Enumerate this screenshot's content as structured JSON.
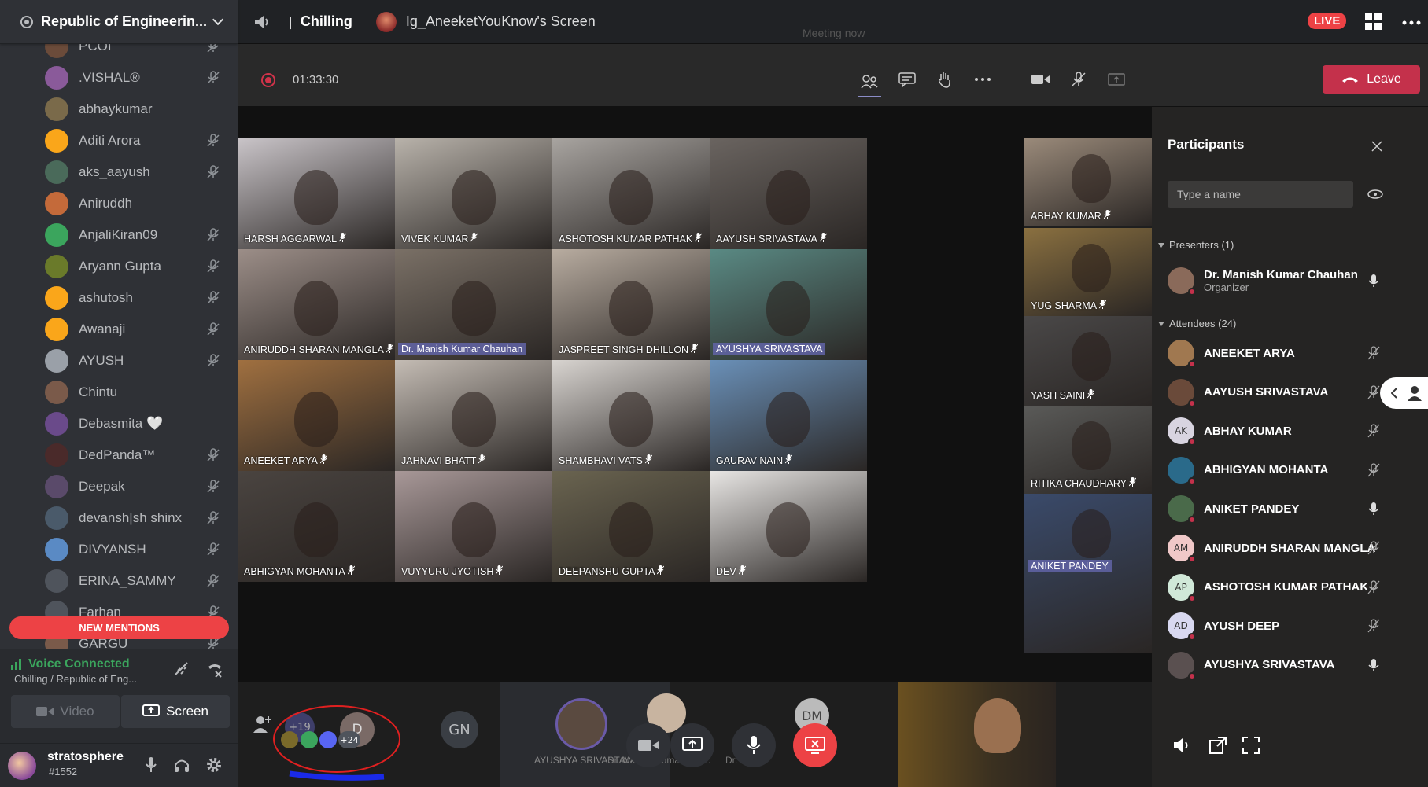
{
  "discord": {
    "server_name": "Republic of Engineerin...",
    "members": [
      {
        "name": "PCOI",
        "muted": true,
        "color": "#6b4b3a"
      },
      {
        "name": ".VISHAL®",
        "muted": true,
        "color": "#8a5a9a"
      },
      {
        "name": "abhaykumar",
        "muted": false,
        "color": "#7a6a4a"
      },
      {
        "name": "Aditi Arora",
        "muted": true,
        "color": "#faa61a"
      },
      {
        "name": "aks_aayush",
        "muted": true,
        "color": "#4a6a5a"
      },
      {
        "name": "Aniruddh",
        "muted": false,
        "color": "#c46a3a"
      },
      {
        "name": "AnjaliKiran09",
        "muted": true,
        "color": "#3ba55d"
      },
      {
        "name": "Aryann Gupta",
        "muted": true,
        "color": "#6a7a2a"
      },
      {
        "name": "ashutosh",
        "muted": true,
        "color": "#faa61a"
      },
      {
        "name": "Awanaji",
        "muted": true,
        "color": "#faa61a"
      },
      {
        "name": "AYUSH",
        "muted": true,
        "color": "#9aa0a8"
      },
      {
        "name": "Chintu",
        "muted": false,
        "color": "#7a5a4a"
      },
      {
        "name": "Debasmita 🤍",
        "muted": false,
        "color": "#6a4a8a"
      },
      {
        "name": "DedPanda™",
        "muted": true,
        "color": "#4a2a2a"
      },
      {
        "name": "Deepak",
        "muted": true,
        "color": "#5a4a6a"
      },
      {
        "name": "devansh|sh shinx",
        "muted": true,
        "color": "#4a5a6a"
      },
      {
        "name": "DIVYANSH",
        "muted": true,
        "color": "#5a8ac4"
      },
      {
        "name": "ERINA_SAMMY",
        "muted": true,
        "color": "#4f545c"
      },
      {
        "name": "Farhan",
        "muted": true,
        "color": "#4f545c"
      },
      {
        "name": "GARGU",
        "muted": true,
        "color": "#7a5a4a"
      }
    ],
    "new_mentions": "NEW MENTIONS",
    "voice_status": "Voice Connected",
    "voice_channel": "Chilling / Republic of Eng...",
    "video_label": "Video",
    "screen_label": "Screen",
    "username": "stratosphere",
    "discriminator": "#1552"
  },
  "topbar": {
    "channel": "Chilling",
    "screen_title": "Ig_AneeketYouKnow's Screen",
    "live_label": "LIVE"
  },
  "teams": {
    "timer": "01:33:30",
    "meeting_now": "Meeting now",
    "leave_label": "Leave",
    "grid_tiles": [
      {
        "name": "HARSH AGGARWAL",
        "bg": "#c9c4c8",
        "col": 0,
        "row": 0,
        "hl": false
      },
      {
        "name": "VIVEK KUMAR",
        "bg": "#b8b2aa",
        "col": 1,
        "row": 0,
        "hl": false
      },
      {
        "name": "ASHOTOSH KUMAR PATHAK",
        "bg": "#a8a4a0",
        "col": 2,
        "row": 0,
        "hl": false
      },
      {
        "name": "AAYUSH SRIVASTAVA",
        "bg": "#6a6460",
        "col": 3,
        "row": 0,
        "hl": false
      },
      {
        "name": "ANIRUDDH SHARAN MANGLA",
        "bg": "#9c8e88",
        "col": 0,
        "row": 1,
        "hl": false
      },
      {
        "name": "Dr. Manish Kumar Chauhan",
        "bg": "#7a7066",
        "col": 1,
        "row": 1,
        "hl": true
      },
      {
        "name": "JASPREET SINGH DHILLON",
        "bg": "#b8aca0",
        "col": 2,
        "row": 1,
        "hl": false
      },
      {
        "name": "AYUSHYA SRIVASTAVA",
        "bg": "#5a8a84",
        "col": 3,
        "row": 1,
        "hl": true
      },
      {
        "name": "ANEEKET ARYA",
        "bg": "#a07040",
        "col": 0,
        "row": 2,
        "hl": false
      },
      {
        "name": "JAHNAVI BHATT",
        "bg": "#c4bcb4",
        "col": 1,
        "row": 2,
        "hl": false
      },
      {
        "name": "SHAMBHAVI VATS",
        "bg": "#d8d4d0",
        "col": 2,
        "row": 2,
        "hl": false
      },
      {
        "name": "GAURAV NAIN",
        "bg": "#6a90b8",
        "col": 3,
        "row": 2,
        "hl": false
      },
      {
        "name": "ABHIGYAN MOHANTA",
        "bg": "#4a4440",
        "col": 0,
        "row": 3,
        "hl": false
      },
      {
        "name": "VUYYURU JYOTISH",
        "bg": "#a89898",
        "col": 1,
        "row": 3,
        "hl": false
      },
      {
        "name": "DEEPANSHU GUPTA",
        "bg": "#6a6450",
        "col": 2,
        "row": 3,
        "hl": false
      },
      {
        "name": "DEV",
        "bg": "#e8e6e4",
        "col": 3,
        "row": 3,
        "hl": false
      }
    ],
    "side_tiles": [
      {
        "name": "ABHAY KUMAR",
        "bg": "#9a8a7a",
        "hl": false
      },
      {
        "name": "YUG SHARMA",
        "bg": "#8a7040",
        "hl": false
      },
      {
        "name": "YASH SAINI",
        "bg": "#4a4848",
        "hl": false
      },
      {
        "name": "RITIKA CHAUDHARY",
        "bg": "#5a5a58",
        "hl": false
      },
      {
        "name": "ANIKET PANDEY",
        "bg": "#3a4a6a",
        "hl": true
      }
    ],
    "panel": {
      "title": "Participants",
      "search_placeholder": "Type a name",
      "presenters_header": "Presenters (1)",
      "attendees_header": "Attendees (24)",
      "presenter": {
        "name": "Dr. Manish Kumar Chauhan",
        "role": "Organizer"
      },
      "attendees": [
        {
          "name": "ANEEKET ARYA",
          "initials": "",
          "bg": "#a07850",
          "mic": "muted"
        },
        {
          "name": "AAYUSH SRIVASTAVA",
          "initials": "",
          "bg": "#6a4a3a",
          "mic": "muted"
        },
        {
          "name": "ABHAY KUMAR",
          "initials": "AK",
          "bg": "#d8d4e0",
          "mic": "muted"
        },
        {
          "name": "ABHIGYAN MOHANTA",
          "initials": "",
          "bg": "#2a6a8a",
          "mic": "muted"
        },
        {
          "name": "ANIKET PANDEY",
          "initials": "",
          "bg": "#4a6a4a",
          "mic": "on"
        },
        {
          "name": "ANIRUDDH SHARAN MANGLA",
          "initials": "AM",
          "bg": "#f0c8c8",
          "mic": "muted"
        },
        {
          "name": "ASHOTOSH KUMAR PATHAK",
          "initials": "AP",
          "bg": "#d0e8d8",
          "mic": "muted"
        },
        {
          "name": "AYUSH DEEP",
          "initials": "AD",
          "bg": "#d8d8f0",
          "mic": "muted"
        },
        {
          "name": "AYUSHYA SRIVASTAVA",
          "initials": "",
          "bg": "#5a5050",
          "mic": "on"
        }
      ]
    },
    "bottom": {
      "count_badge": "+19",
      "count_badge2": "+24",
      "avatar_d": "D",
      "avatar_gn": "GN",
      "avatar_dm": "DM",
      "bottom_name1": "AYUSHYA SRIVASTAVA",
      "bottom_name2": "Dr. Manish Kumar Cha...",
      "bottom_name3": "Dr. Mani"
    }
  }
}
